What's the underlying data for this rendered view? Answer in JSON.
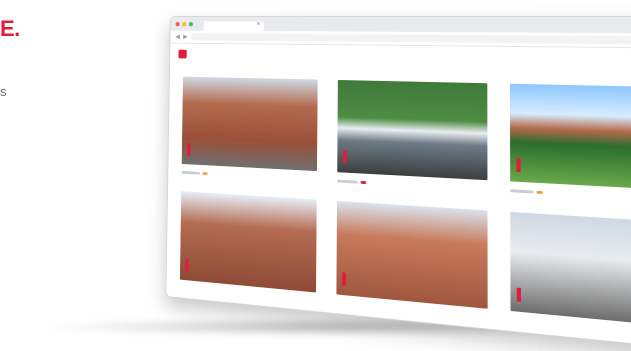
{
  "background": {
    "heading": "E.",
    "tail": "s"
  },
  "browser": {
    "window_controls": [
      "close-dot",
      "minimize-dot",
      "maximize-dot"
    ],
    "url": "",
    "tab_close_glyph": "×"
  },
  "site": {
    "menu": [
      "",
      "",
      "",
      "",
      "",
      "",
      ""
    ]
  },
  "listings": [
    {
      "title": "",
      "subtitle": ""
    },
    {
      "title": "",
      "subtitle": ""
    },
    {
      "title": "",
      "subtitle": ""
    },
    {
      "title": "",
      "subtitle": ""
    },
    {
      "title": "",
      "subtitle": ""
    },
    {
      "title": "",
      "subtitle": ""
    }
  ],
  "colors": {
    "brand_red": "#e11d3a",
    "title_blue": "#1a2a6c",
    "accent_orange": "#f0a43c"
  }
}
